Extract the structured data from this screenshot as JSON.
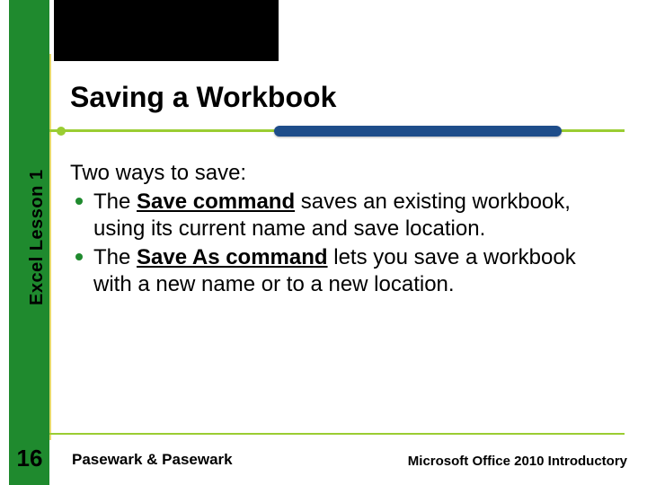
{
  "lesson_label": "Excel Lesson 1",
  "page_number": "16",
  "title": "Saving a Workbook",
  "body": {
    "intro": "Two ways to save:",
    "items": [
      {
        "keyword": "Save command",
        "rest": " saves an existing workbook, using its current name and save location."
      },
      {
        "keyword": "Save As command",
        "rest": " lets you save a workbook with a new name or to a new location."
      }
    ],
    "the_prefix": "The "
  },
  "footer": {
    "left": "Pasewark & Pasewark",
    "right": "Microsoft Office 2010 Introductory"
  }
}
